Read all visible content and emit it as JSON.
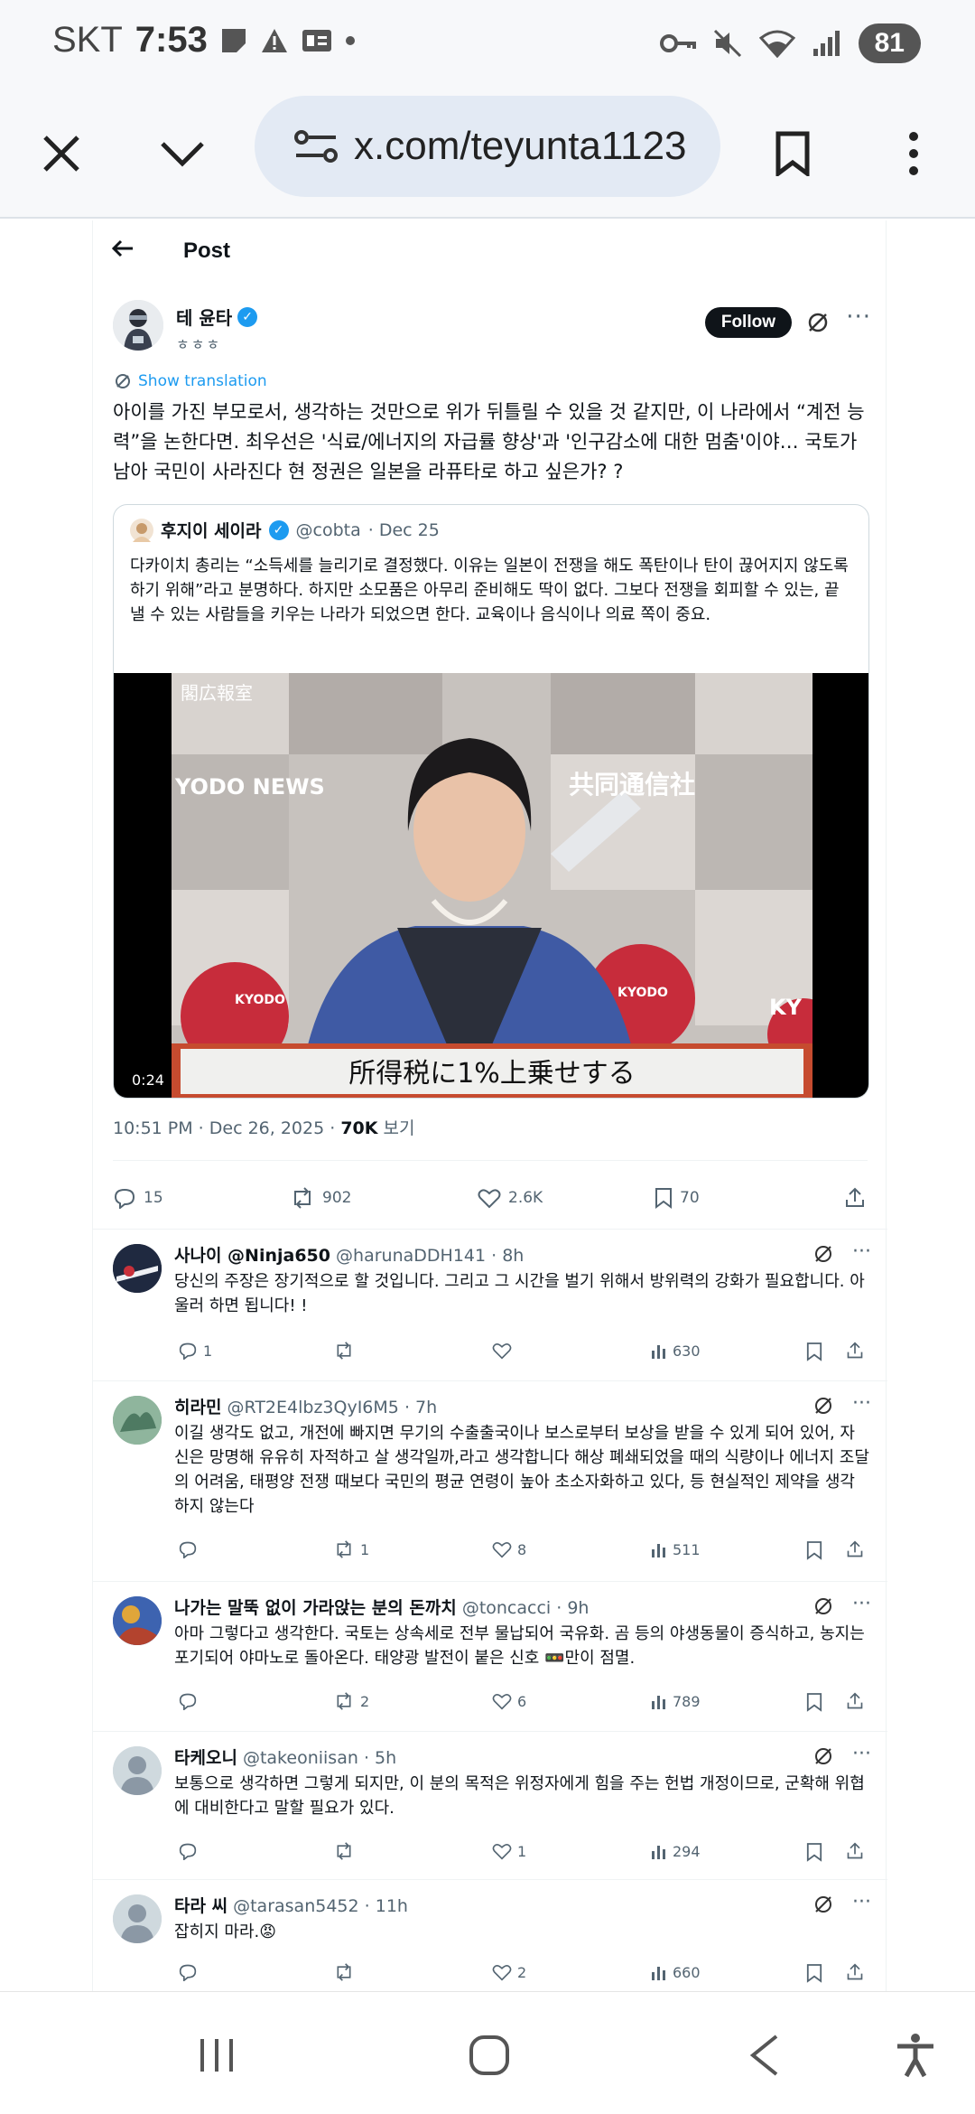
{
  "status_bar": {
    "carrier": "SKT",
    "time": "7:53",
    "battery": "81"
  },
  "browser": {
    "url": "x.com/teyunta1123",
    "icons": [
      "close-icon",
      "chevron-down-icon",
      "site-settings-icon",
      "bookmark-icon",
      "more-vert-icon"
    ]
  },
  "header": {
    "title": "Post"
  },
  "post": {
    "author_name": "테 윤타",
    "author_sub": "ㅎㅎㅎ",
    "follow_label": "Follow",
    "show_translation": "Show translation",
    "text": "아이를 가진 부모로서, 생각하는 것만으로 위가 뒤틀릴 수 있을 것 같지만, 이 나라에서 “계전 능력”을 논한다면. 최우선은 '식료/에너지의 자급률 향상'과 '인구감소에 대한 멈춤'이야… 국토가 남아 국민이 사라진다 현 정권은 일본을 라퓨타로 하고 싶은가? ?",
    "quote": {
      "author_name": "후지이 세이라",
      "handle": "@cobta",
      "date": "· Dec 25",
      "text": "다카이치 총리는 “소득세를 늘리기로 결정했다. 이유는 일본이 전쟁을 해도 폭탄이나 탄이 끊어지지 않도록 하기 위해”라고 분명하다. 하지만 소모품은 아무리 준비해도 딱이 없다. 그보다 전쟁을 회피할 수 있는, 끝낼 수 있는 사람들을 키우는 나라가 되었으면 한다. 교육이나 음식이나 의료 쪽이 중요.",
      "video_duration": "0:24",
      "video_texts": {
        "corner": "閣広報室",
        "kyodo_left": "YODO NEWS",
        "kyodo_right": "共同通信社",
        "caption": "所得税に1%上乗せする",
        "logo1": "KYODO",
        "logo2": "KYODO",
        "logo3": "KY"
      }
    },
    "timestamp": "10:51 PM · Dec 26, 2025 · ",
    "views_count": "70K",
    "views_label": " 보기",
    "stats": {
      "replies": "15",
      "reposts": "902",
      "likes": "2.6K",
      "bookmarks": "70"
    }
  },
  "replies": [
    {
      "name": "사나이 @Ninja650",
      "handle": "@harunaDDH141",
      "time": "· 8h",
      "text": "당신의 주장은 장기적으로 할 것입니다. 그리고 그 시간을 벌기 위해서 방위력의 강화가 필요합니다. 아울러 하면 됩니다! !",
      "replies": "1",
      "reposts": "",
      "likes": "",
      "views": "630"
    },
    {
      "name": "히라민",
      "handle": "@RT2E4lbz3QyI6M5",
      "time": "· 7h",
      "text": "이길 생각도 없고, 개전에 빠지면 무기의 수출출국이나 보스로부터 보상을 받을 수 있게 되어 있어, 자신은 망명해 유유히 자적하고 살 생각일까,라고 생각합니다 해상 폐쇄되었을 때의 식량이나 에너지 조달의 어려움, 태평양 전쟁 때보다 국민의 평균 연령이 높아 초소자화하고 있다, 등 현실적인 제약을 생각하지 않는다",
      "replies": "",
      "reposts": "1",
      "likes": "8",
      "views": "511"
    },
    {
      "name": "나가는 말뚝 없이 가라앉는 분의 돈까치",
      "handle": "@toncacci",
      "time": "· 9h",
      "text": "아마 그렇다고 생각한다. 국토는 상속세로 전부 물납되어 국유화. 곰 등의 야생동물이 증식하고, 농지는 포기되어 야마노로 돌아온다. 태양광 발전이 붙은 신호 🚥만이 점멸.",
      "replies": "",
      "reposts": "2",
      "likes": "6",
      "views": "789"
    },
    {
      "name": "타케오니",
      "handle": "@takeoniisan",
      "time": "· 5h",
      "text": "보통으로 생각하면 그렇게 되지만, 이 분의 목적은 위정자에게 힘을 주는 헌법 개정이므로, 군확해 위협에 대비한다고 말할 필요가 있다.",
      "replies": "",
      "reposts": "",
      "likes": "1",
      "views": "294"
    },
    {
      "name": "타라 씨",
      "handle": "@tarasan5452",
      "time": "· 11h",
      "text": "잡히지 마라.😡",
      "replies": "",
      "reposts": "",
      "likes": "2",
      "views": "660"
    }
  ],
  "colors": {
    "accent": "#1d9bf0",
    "text": "#0f1419",
    "muted": "#536471",
    "caption_border": "#d9442b"
  }
}
